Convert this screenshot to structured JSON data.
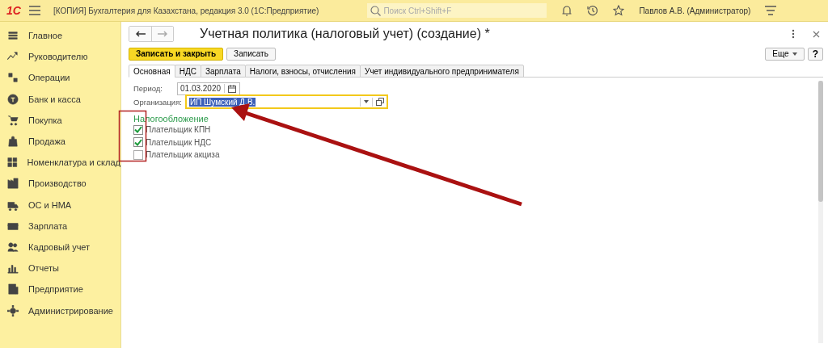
{
  "app": {
    "logo": "1С",
    "title": "[КОПИЯ] Бухгалтерия для Казахстана, редакция 3.0  (1С:Предприятие)",
    "search_placeholder": "Поиск Ctrl+Shift+F",
    "user": "Павлов А.В. (Администратор)"
  },
  "sidebar": {
    "items": [
      {
        "label": "Главное",
        "selected": false
      },
      {
        "label": "Руководителю",
        "selected": false
      },
      {
        "label": "Операции",
        "selected": false
      },
      {
        "label": "Банк и касса",
        "selected": false
      },
      {
        "label": "Покупка",
        "selected": false
      },
      {
        "label": "Продажа",
        "selected": false
      },
      {
        "label": "Номенклатура и склад",
        "selected": false
      },
      {
        "label": "Производство",
        "selected": false
      },
      {
        "label": "ОС и НМА",
        "selected": false
      },
      {
        "label": "Зарплата",
        "selected": false
      },
      {
        "label": "Кадровый учет",
        "selected": false
      },
      {
        "label": "Отчеты",
        "selected": false
      },
      {
        "label": "Предприятие",
        "selected": false
      },
      {
        "label": "Администрирование",
        "selected": false
      }
    ]
  },
  "form": {
    "title": "Учетная политика (налоговый учет) (создание) *",
    "buttons": [
      {
        "label": "Записать и закрыть",
        "kind": "primary"
      },
      {
        "label": "Записать",
        "kind": "normal"
      }
    ],
    "more_button": "Еще",
    "help_button": "?",
    "tabs": [
      {
        "label": "Основная",
        "selected": true
      },
      {
        "label": "НДС",
        "selected": false
      },
      {
        "label": "Зарплата",
        "selected": false
      },
      {
        "label": "Налоги, взносы, отчисления",
        "selected": false
      },
      {
        "label": "Учет индивидуального предпринимателя",
        "selected": false
      }
    ],
    "period": {
      "label": "Период:",
      "value": "01.03.2020"
    },
    "organization": {
      "label": "Организация:",
      "value": "ИП Шумский Д.В.",
      "focused": true
    },
    "section": "Налогообложение",
    "checkboxes": [
      {
        "label": "Плательщик КПН",
        "checked": true
      },
      {
        "label": "Плательщик НДС",
        "checked": true
      },
      {
        "label": "Плательщик акциза",
        "checked": false
      }
    ]
  }
}
